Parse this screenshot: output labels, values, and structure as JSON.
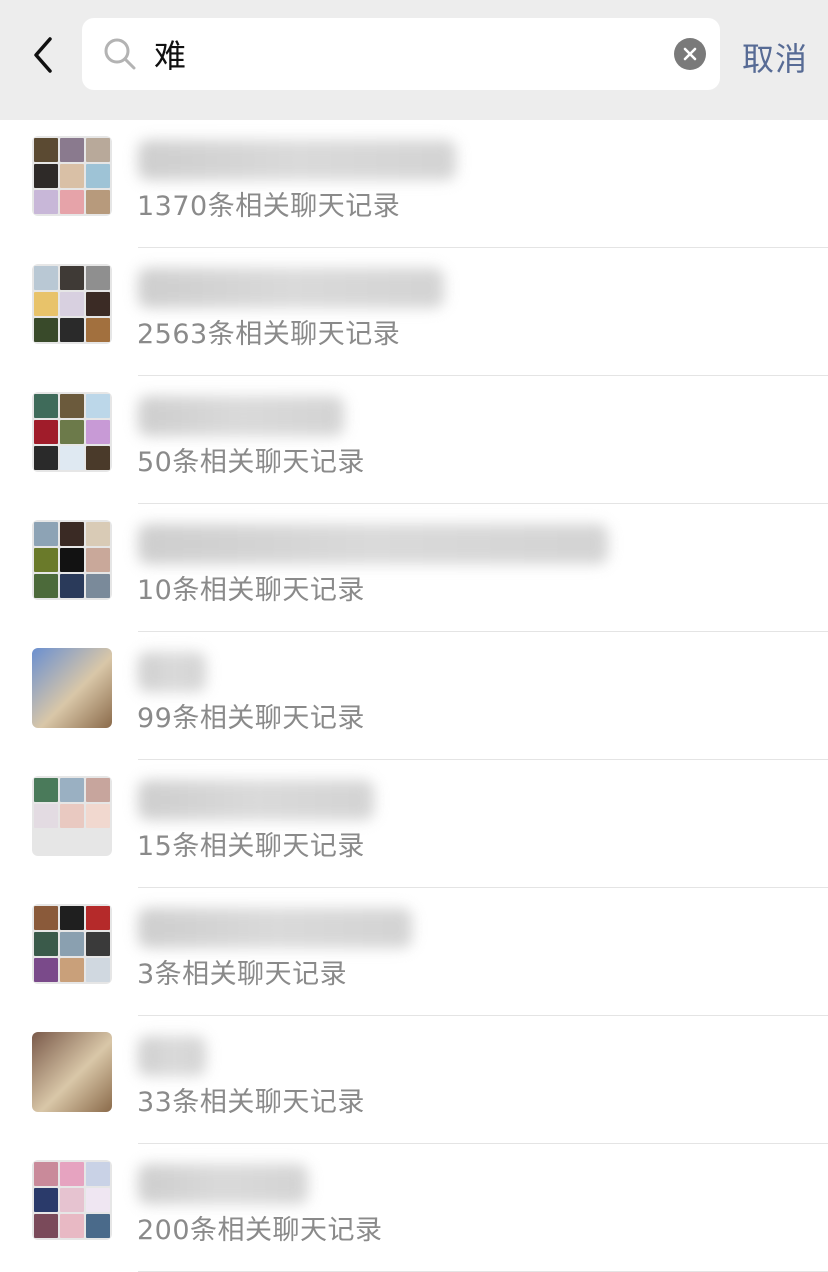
{
  "search": {
    "query": "难",
    "cancel_label": "取消"
  },
  "results": [
    {
      "count_text": "1370条相关聊天记录",
      "avatar_colors": [
        "#5b4a32",
        "#8a7a8e",
        "#b8a99a",
        "#2e2a28",
        "#d9c0a6",
        "#9ec3d6",
        "#c8b7d8",
        "#e6a3a9",
        "#b79a7c"
      ]
    },
    {
      "count_text": "2563条相关聊天记录",
      "avatar_colors": [
        "#b9c8d4",
        "#3f3a36",
        "#8f8f8f",
        "#e8c36a",
        "#d8d0e0",
        "#3b2b25",
        "#394a2a",
        "#2a2a2a",
        "#a2703e"
      ]
    },
    {
      "count_text": "50条相关聊天记录",
      "avatar_colors": [
        "#3f6b5a",
        "#6b5a3c",
        "#bcd7e9",
        "#a01c2a",
        "#6c7a4a",
        "#c89ad6",
        "#2a2a2a",
        "#dfe9f2",
        "#4a3a2a"
      ]
    },
    {
      "count_text": "10条相关聊天记录",
      "avatar_colors": [
        "#8da3b5",
        "#3a2a24",
        "#d9cbb6",
        "#6a7a2a",
        "#121212",
        "#c9a89a",
        "#4c6a3a",
        "#2a3a5a",
        "#7a8a9a"
      ]
    },
    {
      "count_text": "99条相关聊天记录",
      "avatar_colors": [
        "#6a8fd0"
      ]
    },
    {
      "count_text": "15条相关聊天记录",
      "avatar_colors": [
        "#4a7a5a",
        "#9ab0c2",
        "#c7a59d",
        "#e3dbe2",
        "#e9c9c1",
        "#f1d8cf"
      ]
    },
    {
      "count_text": "3条相关聊天记录",
      "avatar_colors": [
        "#8a5a3a",
        "#1f1f1f",
        "#b52a2a",
        "#3a5a4a",
        "#8aa0b0",
        "#3a3a3a",
        "#7a4a8a",
        "#c9a07a",
        "#d0d8e0"
      ]
    },
    {
      "count_text": "33条相关聊天记录",
      "avatar_colors": [
        "#7a5a4a"
      ]
    },
    {
      "count_text": "200条相关聊天记录",
      "avatar_colors": [
        "#c98a9a",
        "#e6a3c0",
        "#c9d2e6",
        "#2a3a6a",
        "#e6c3d0",
        "#efe6f2",
        "#7a4a5a",
        "#e8b9c4",
        "#4a6a8a"
      ]
    }
  ]
}
